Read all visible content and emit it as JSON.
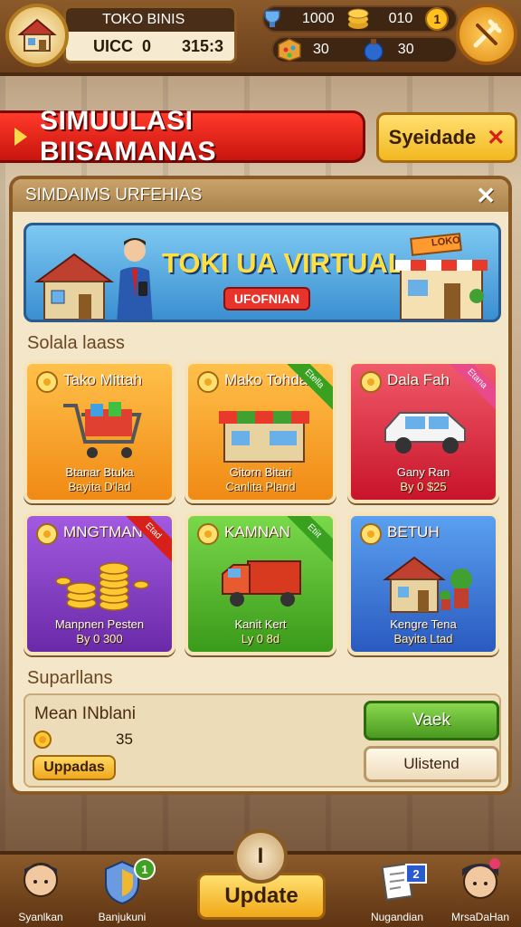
{
  "topbar": {
    "profile_title": "TOKO BINIS",
    "profile_name": "UICC",
    "profile_level": "0",
    "profile_value": "315:3",
    "res_a": "1000",
    "res_b": "010",
    "res_c": "30",
    "res_d": "30",
    "badge": "1"
  },
  "banner": {
    "title": "SIMUULASI BIISAMANAS",
    "side_button": "Syeidade"
  },
  "panel": {
    "header": "SIMDAIMS URFEHIAS",
    "promo_title": "TOKI UA VIRTUAL",
    "promo_button": "UFOFNIAN",
    "promo_sign": "LOKO",
    "section1": "Solala laass",
    "section2": "Suparllans",
    "cards": [
      {
        "title": "Tako Mittah",
        "line1": "Btanar Btuka",
        "line2": "Bayita D'lad",
        "ribbon": ""
      },
      {
        "title": "Mako Tohdah",
        "line1": "Gitorn Bitari",
        "line2": "Canlita Pland",
        "ribbon": "Etella"
      },
      {
        "title": "Dala Fah",
        "line1": "Gany Ran",
        "line2": "By 0 $25",
        "ribbon": "Etana"
      },
      {
        "title": "MNGTMAN",
        "line1": "Manpnen Pesten",
        "line2": "By 0 300",
        "ribbon": "Etad"
      },
      {
        "title": "KAMNAN",
        "line1": "Kanit Kert",
        "line2": "Ly 0 8d",
        "ribbon": "Etiit"
      },
      {
        "title": "BETUH",
        "line1": "Kengre Tena",
        "line2": "Bayita Ltad",
        "ribbon": ""
      }
    ],
    "mgmt": {
      "name": "Mean INblani",
      "coins": "35",
      "update": "Uppadas",
      "btn_primary": "Vaek",
      "btn_secondary": "Ulistend"
    }
  },
  "bottom": {
    "left1": "Syanlkan",
    "left2": "Banjukuni",
    "left2_badge": "1",
    "center": "Update",
    "center_knob": "I",
    "right1": "Nugandian",
    "right1_badge": "2",
    "right2": "MrsaDaHan"
  }
}
